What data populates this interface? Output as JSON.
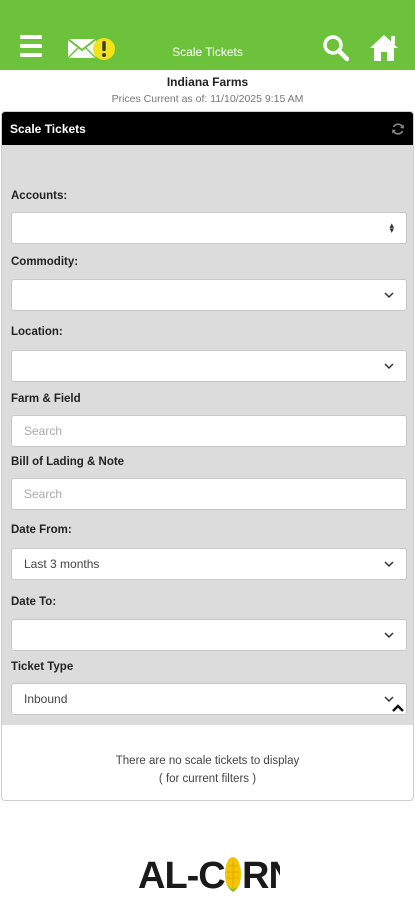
{
  "header": {
    "title": "Scale Tickets",
    "icons": [
      "menu-icon",
      "mail-alert-icon",
      "search-icon",
      "home-icon"
    ],
    "brand_color": "#6cc23a"
  },
  "info": {
    "farm_name": "Indiana Farms",
    "prices_current": "Prices Current as of: 11/10/2025 9:15 AM"
  },
  "panel": {
    "title": "Scale Tickets"
  },
  "filters": {
    "accounts": {
      "label": "Accounts:",
      "value": ""
    },
    "commodity": {
      "label": "Commodity:",
      "value": ""
    },
    "location": {
      "label": "Location:",
      "value": ""
    },
    "farm_field": {
      "label": "Farm & Field",
      "placeholder": "Search"
    },
    "bill_of_lading": {
      "label": "Bill of Lading & Note",
      "placeholder": "Search"
    },
    "date_from": {
      "label": "Date From:",
      "value": "Last 3 months"
    },
    "date_to": {
      "label": "Date To:",
      "value": ""
    },
    "ticket_type": {
      "label": "Ticket Type",
      "value": "Inbound"
    }
  },
  "results": {
    "empty_line1": "There are no scale tickets to display",
    "empty_line2": "( for current filters )"
  },
  "footer": {
    "logo_text": "AL-CORN"
  }
}
